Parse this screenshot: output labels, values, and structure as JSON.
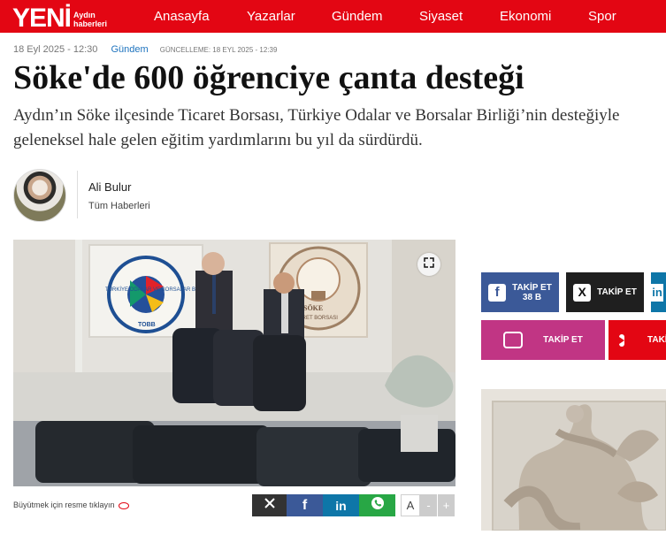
{
  "site": {
    "logo_main": "YENİ",
    "logo_sub_1": "Aydın",
    "logo_sub_2": "haberleri",
    "brand_color": "#e30613"
  },
  "nav": {
    "items": [
      "Anasayfa",
      "Yazarlar",
      "Gündem",
      "Siyaset",
      "Ekonomi",
      "Spor"
    ]
  },
  "article": {
    "date": "18 Eyl 2025 - 12:30",
    "category": "Gündem",
    "updated": "GÜNCELLEME: 18 Eyl 2025 - 12:39",
    "title": "Söke'de 600 öğrenciye çanta desteği",
    "lede": "Aydın’ın Söke ilçesinde Ticaret Borsası, Türkiye Odalar ve Borsalar Birliği’nin desteğiyle geleneksel hale gelen eğitim yardımlarını bu yıl da sürdürdü."
  },
  "author": {
    "name": "Ali Bulur",
    "link": "Tüm Haberleri"
  },
  "photo": {
    "caption": "Büyütmek için resme tıklayın",
    "logo_left_text": "TÜRKİYE ODALAR VE BORSALAR BİRLİĞİ",
    "logo_left_sub": "TOBB",
    "logo_right_text": "SÖKE",
    "logo_right_sub": "TİCARET BORSASI"
  },
  "share": {
    "x": "X",
    "facebook": "f",
    "linkedin": "in",
    "whatsapp": "whatsapp"
  },
  "font_controls": {
    "a": "A",
    "minus": "-",
    "plus": "+"
  },
  "social": {
    "facebook": {
      "label": "TAKİP ET",
      "count": "38 B",
      "color": "#3b5998"
    },
    "x": {
      "label": "TAKİP ET",
      "color": "#1f1f1f"
    },
    "instagram": {
      "label": "TAKİP ET",
      "color": "#c13584"
    },
    "youtube": {
      "label": "TAKİP ET",
      "color": "#e30613"
    }
  }
}
